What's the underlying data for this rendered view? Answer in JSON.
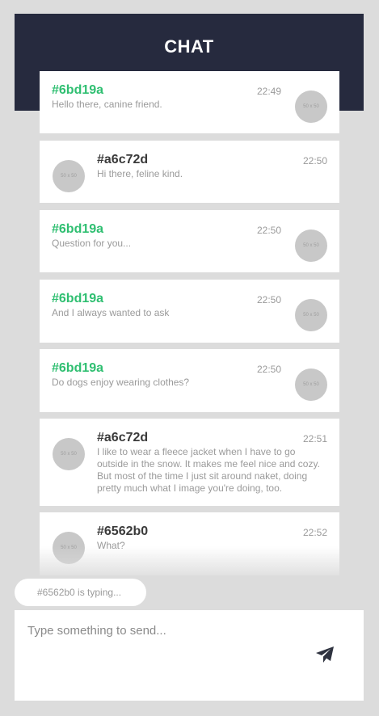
{
  "header": {
    "title": "CHAT"
  },
  "avatar_placeholder": "50 x 50",
  "messages": [
    {
      "author": "#6bd19a",
      "time": "22:49",
      "text": "Hello there, canine friend.",
      "side": "self",
      "author_color": "#2fbf71"
    },
    {
      "author": "#a6c72d",
      "time": "22:50",
      "text": "Hi there, feline kind.",
      "side": "other"
    },
    {
      "author": "#6bd19a",
      "time": "22:50",
      "text": "Question for you...",
      "side": "self",
      "author_color": "#2fbf71"
    },
    {
      "author": "#6bd19a",
      "time": "22:50",
      "text": "And I always wanted to ask",
      "side": "self",
      "author_color": "#2fbf71"
    },
    {
      "author": "#6bd19a",
      "time": "22:50",
      "text": "Do dogs enjoy wearing clothes?",
      "side": "self",
      "author_color": "#2fbf71"
    },
    {
      "author": "#a6c72d",
      "time": "22:51",
      "text": "I like to wear a fleece jacket when I have to go outside in the snow. It makes me feel nice and cozy. But most of the time I just sit around naket, doing pretty much what I image you're doing, too.",
      "side": "other"
    },
    {
      "author": "#6562b0",
      "time": "22:52",
      "text": "What?",
      "side": "other"
    }
  ],
  "typing_indicator": "#6562b0 is typing...",
  "composer": {
    "placeholder": "Type something to send...",
    "send_icon": "paper-plane-icon"
  },
  "colors": {
    "header_bg": "#262a3e",
    "page_bg": "#dcdcdc",
    "self_author": "#2fbf71"
  }
}
